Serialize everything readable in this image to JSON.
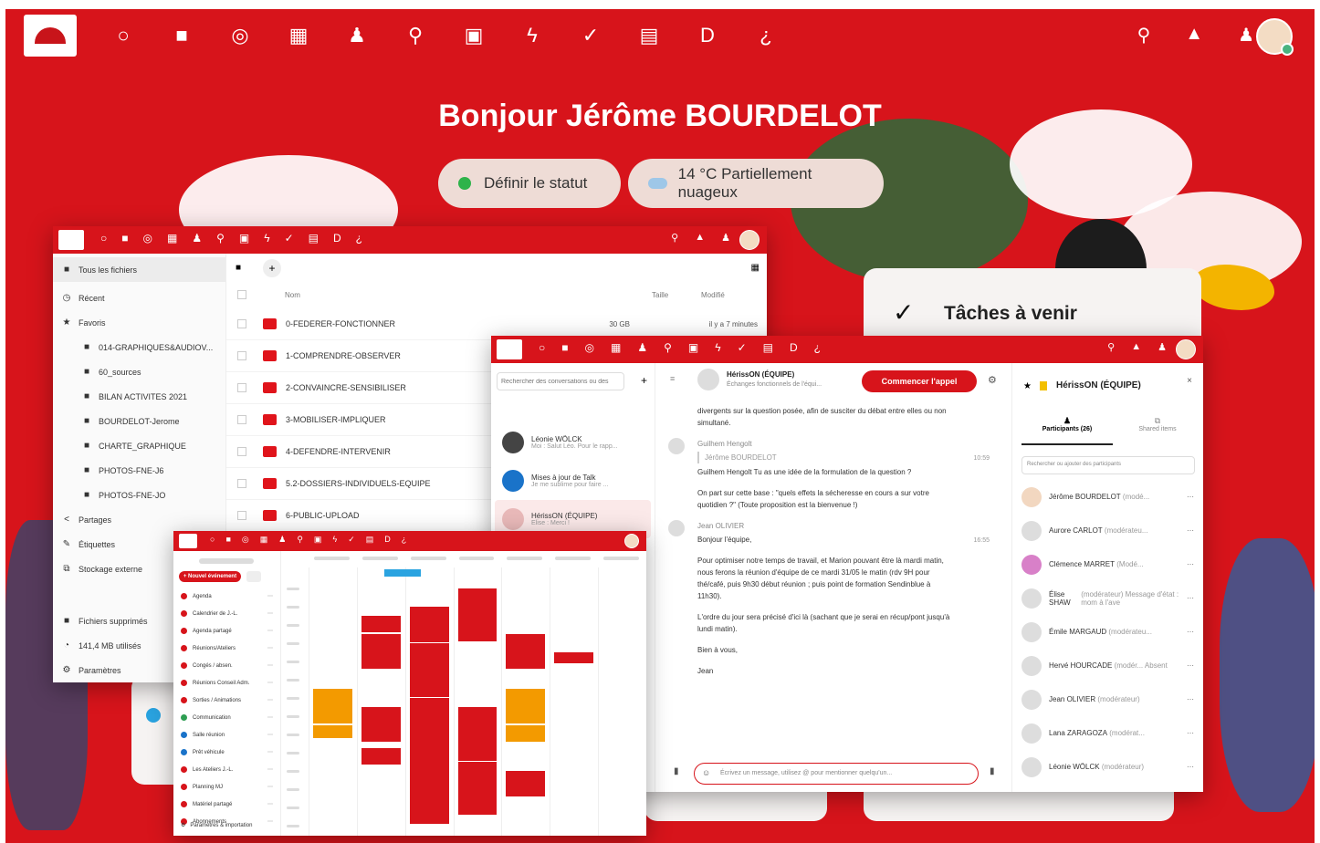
{
  "header": {
    "greeting": "Bonjour Jérôme BOURDELOT",
    "status_button": "Définir le statut",
    "weather": "14 °C Partiellement nuageux"
  },
  "nav": {
    "icons": [
      "dashboard-icon",
      "files-icon",
      "talk-icon",
      "calendar-icon",
      "contacts-icon",
      "passwords-icon",
      "photos-icon",
      "activity-icon",
      "tasks-icon",
      "deck-icon",
      "dokuwiki-icon",
      "help-icon"
    ],
    "glyphs": [
      "○",
      "■",
      "◎",
      "▦",
      "♟",
      "⚲",
      "▣",
      "ϟ",
      "✓",
      "▤",
      "D",
      "¿"
    ]
  },
  "tasks_widget": {
    "title": "Tâches à venir"
  },
  "files_window": {
    "breadcrumb": "Tous les fichiers",
    "sidebar": [
      {
        "icon": "clock-icon",
        "glyph": "◷",
        "label": "Récent"
      },
      {
        "icon": "star-icon",
        "glyph": "★",
        "label": "Favoris"
      },
      {
        "icon": "folder-icon",
        "glyph": "■",
        "label": "014-GRAPHIQUES&AUDIOV...",
        "sub": true
      },
      {
        "icon": "folder-icon",
        "glyph": "■",
        "label": "60_sources",
        "sub": true
      },
      {
        "icon": "folder-icon",
        "glyph": "■",
        "label": "BILAN ACTIVITES 2021",
        "sub": true
      },
      {
        "icon": "folder-icon",
        "glyph": "■",
        "label": "BOURDELOT-Jerome",
        "sub": true
      },
      {
        "icon": "folder-icon",
        "glyph": "■",
        "label": "CHARTE_GRAPHIQUE",
        "sub": true
      },
      {
        "icon": "folder-icon",
        "glyph": "■",
        "label": "PHOTOS-FNE-J6",
        "sub": true
      },
      {
        "icon": "folder-icon",
        "glyph": "■",
        "label": "PHOTOS-FNE-JO",
        "sub": true
      },
      {
        "icon": "share-icon",
        "glyph": "<",
        "label": "Partages"
      },
      {
        "icon": "tag-icon",
        "glyph": "✎",
        "label": "Étiquettes"
      },
      {
        "icon": "external-storage-icon",
        "glyph": "⧉",
        "label": "Stockage externe"
      }
    ],
    "sidebar_bottom": [
      {
        "icon": "trash-icon",
        "glyph": "■",
        "label": "Fichiers supprimés"
      },
      {
        "icon": "quota-icon",
        "glyph": "◔",
        "label": "141,4 MB utilisés"
      },
      {
        "icon": "settings-icon",
        "glyph": "⚙",
        "label": "Paramètres"
      }
    ],
    "columns": {
      "name": "Nom",
      "size": "Taille",
      "modified": "Modifié"
    },
    "rows": [
      {
        "name": "0-FEDERER-FONCTIONNER",
        "size": "30 GB",
        "modified": "il y a 7 minutes"
      },
      {
        "name": "1-COMPRENDRE-OBSERVER",
        "size": "",
        "modified": ""
      },
      {
        "name": "2-CONVAINCRE-SENSIBILISER",
        "size": "",
        "modified": ""
      },
      {
        "name": "3-MOBILISER-IMPLIQUER",
        "size": "",
        "modified": ""
      },
      {
        "name": "4-DEFENDRE-INTERVENIR",
        "size": "",
        "modified": ""
      },
      {
        "name": "5.2-DOSSIERS-INDIVIDUELS-EQUIPE",
        "size": "",
        "modified": ""
      },
      {
        "name": "6-PUBLIC-UPLOAD",
        "size": "",
        "modified": ""
      }
    ]
  },
  "talk_window": {
    "search_placeholder": "Rechercher des conversations ou des",
    "conversations": [
      {
        "name": "Léonie WÖLCK",
        "preview": "Moi : Salut Léo. Pour le rapp...",
        "color": "#444"
      },
      {
        "name": "Mises à jour de Talk",
        "preview": "Je me sublime pour faire ...",
        "color": "#1a73c9"
      },
      {
        "name": "HérissON (ÉQUIPE)",
        "preview": "Elise : Merci !",
        "color": "#e9b9b9"
      }
    ],
    "room_title": "HérissON (ÉQUIPE)",
    "room_subtitle": "Échanges fonctionnels de l'équi...",
    "call_button": "Commencer l'appel",
    "messages": [
      {
        "author": "",
        "text": "divergents sur la question posée, afin de susciter du débat entre elles ou non simultané.",
        "time": ""
      },
      {
        "author": "Guilhem Hengolt",
        "quote": "Jérôme BOURDELOT",
        "text": "Guilhem Hengolt Tu as une idée de la formulation de la question ?",
        "time": "10:59"
      },
      {
        "author": "",
        "text": "On part sur cette base : \"quels effets la sécheresse en cours a sur votre quotidien ?\" (Toute proposition est la bienvenue !)",
        "time": ""
      },
      {
        "author": "Jean OLIVIER",
        "text": "Bonjour l'équipe,",
        "time": "16:55"
      },
      {
        "author": "",
        "text": "Pour optimiser notre temps de travail, et Marion pouvant être là mardi matin, nous ferons la réunion d'équipe de ce mardi 31/05 le matin (rdv 9H pour thé/café, puis 9h30 début réunion ; puis point de formation Sendinblue à 11h30).",
        "time": ""
      },
      {
        "author": "",
        "text": "L'ordre du jour sera précisé d'ici là (sachant que je serai en récup/pont jusqu'à lundi matin).",
        "time": ""
      },
      {
        "author": "",
        "text": "Bien à vous,",
        "time": ""
      },
      {
        "author": "",
        "text": "Jean",
        "time": ""
      }
    ],
    "compose_placeholder": "Écrivez un message, utilisez @ pour mentionner quelqu'un...",
    "panel_title": "HérissON (ÉQUIPE)",
    "tabs": [
      {
        "label": "Participants (26)"
      },
      {
        "label": "Shared items"
      }
    ],
    "participant_search": "Rechercher ou ajouter des participants",
    "participants": [
      {
        "name": "Jérôme BOURDELOT",
        "role": "(modé...",
        "color": "#f2d7c0"
      },
      {
        "name": "Aurore CARLOT",
        "role": "(modérateu...",
        "color": "#ddd"
      },
      {
        "name": "Clémence MARRET",
        "role": "(Modé...",
        "color": "#d880c8"
      },
      {
        "name": "Élise SHAW",
        "role": "(modérateur) Message d'état : mom à l'ave",
        "color": "#ddd"
      },
      {
        "name": "Émile MARGAUD",
        "role": "(modérateu...",
        "color": "#ddd"
      },
      {
        "name": "Hervé HOURCADE",
        "role": "(modér... Absent",
        "color": "#ddd"
      },
      {
        "name": "Jean OLIVIER",
        "role": "(modérateur)",
        "color": "#ddd"
      },
      {
        "name": "Lana ZARAGOZA",
        "role": "(modérat...",
        "color": "#ddd"
      },
      {
        "name": "Léonie WÖLCK",
        "role": "(modérateur)",
        "color": "#ddd"
      }
    ]
  },
  "calendar_window": {
    "new_event": "+ Nouvel événement",
    "calendars": [
      {
        "name": "Agenda",
        "color": "#d7141b"
      },
      {
        "name": "Calendrier de J.-L.",
        "color": "#d7141b"
      },
      {
        "name": "Agenda partagé",
        "color": "#d7141b"
      },
      {
        "name": "Réunions/Ateliers",
        "color": "#d7141b"
      },
      {
        "name": "Congés / absen.",
        "color": "#d7141b"
      },
      {
        "name": "Réunions Conseil Adm.",
        "color": "#d7141b"
      },
      {
        "name": "Sorties / Animations",
        "color": "#d7141b"
      },
      {
        "name": "Communication",
        "color": "#2e9e52"
      },
      {
        "name": "Salle réunion",
        "color": "#1a73c9"
      },
      {
        "name": "Prêt véhicule",
        "color": "#1a73c9"
      },
      {
        "name": "Les Ateliers J.-L.",
        "color": "#d7141b"
      },
      {
        "name": "Planning MJ",
        "color": "#d7141b"
      },
      {
        "name": "Matériel partagé",
        "color": "#d7141b"
      },
      {
        "name": "Abonnements",
        "color": "#d7141b"
      }
    ],
    "footer": "Paramètres & importation"
  },
  "colors": {
    "brand": "#d7141b",
    "event_alt": "#f39a00",
    "online": "#49b380"
  }
}
